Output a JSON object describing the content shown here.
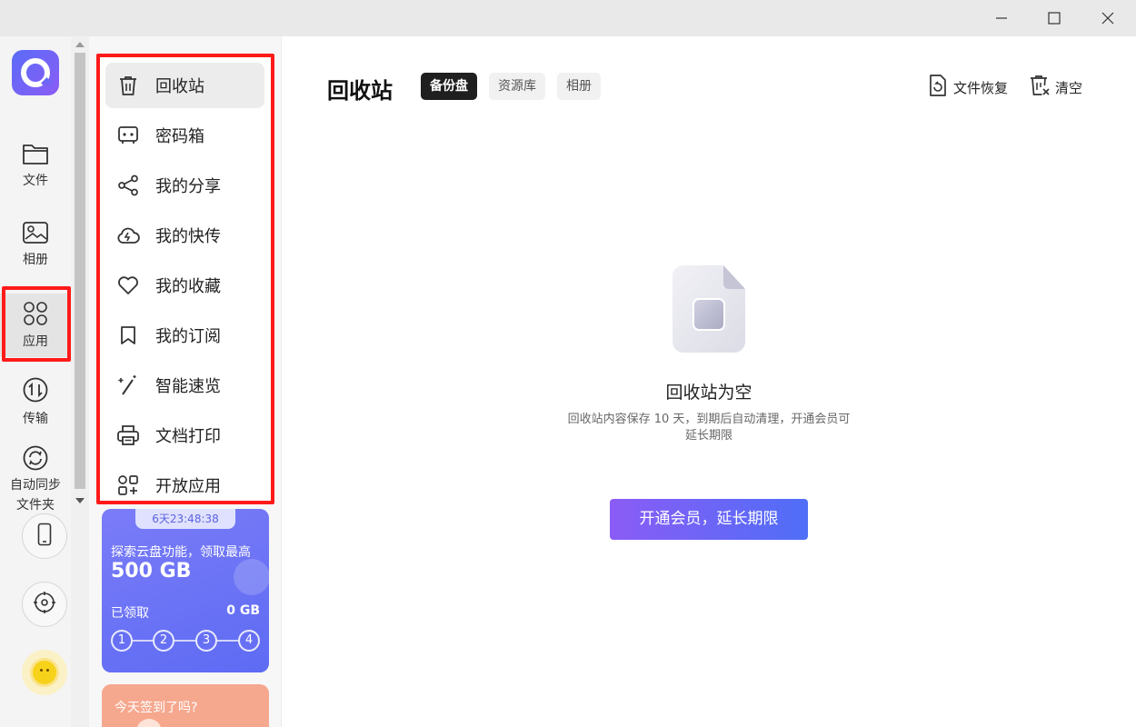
{
  "window": {
    "minimize_icon": "minimize-icon",
    "maximize_icon": "maximize-icon",
    "close_icon": "close-icon"
  },
  "rail": {
    "items": [
      {
        "label": "文件",
        "icon": "folder-icon"
      },
      {
        "label": "相册",
        "icon": "photo-icon"
      },
      {
        "label": "应用",
        "icon": "apps-grid-icon"
      },
      {
        "label": "传输",
        "icon": "transfer-icon"
      },
      {
        "label": "自动同步\n文件夹",
        "label_line1": "自动同步",
        "label_line2": "文件夹",
        "icon": "sync-icon"
      }
    ],
    "buttons": [
      "phone-icon",
      "settings-gear-icon"
    ],
    "avatar": "avatar"
  },
  "menu": {
    "items": [
      {
        "label": "回收站",
        "icon": "trash-icon"
      },
      {
        "label": "密码箱",
        "icon": "safe-box-icon"
      },
      {
        "label": "我的分享",
        "icon": "share-icon"
      },
      {
        "label": "我的快传",
        "icon": "cloud-bolt-icon"
      },
      {
        "label": "我的收藏",
        "icon": "heart-icon"
      },
      {
        "label": "我的订阅",
        "icon": "bookmark-icon"
      },
      {
        "label": "智能速览",
        "icon": "magic-wand-icon"
      },
      {
        "label": "文档打印",
        "icon": "printer-icon"
      },
      {
        "label": "开放应用",
        "icon": "open-apps-icon"
      }
    ]
  },
  "promo": {
    "timer": "6天23:48:38",
    "line1": "探索云盘功能，领取最高",
    "line2": "500 GB",
    "claimed_label": "已领取",
    "claimed_value": "0 GB",
    "steps": [
      "1",
      "2",
      "3",
      "4"
    ]
  },
  "signin": {
    "text": "今天签到了吗?"
  },
  "main": {
    "title": "回收站",
    "tabs": [
      "备份盘",
      "资源库",
      "相册"
    ],
    "active_tab": "备份盘",
    "actions": [
      {
        "label": "文件恢复",
        "icon": "file-restore-icon"
      },
      {
        "label": "清空",
        "icon": "clear-trash-icon"
      }
    ],
    "empty_title": "回收站为空",
    "empty_desc_line1": "回收站内容保存 10 天，到期后自动清理，开通会员可",
    "empty_desc_line2": "延长期限",
    "vip_button": "开通会员，延长期限"
  },
  "colors": {
    "highlight_red": "#ff1a1a",
    "accent_start": "#8b5cf6",
    "accent_end": "#4f6ef7"
  }
}
